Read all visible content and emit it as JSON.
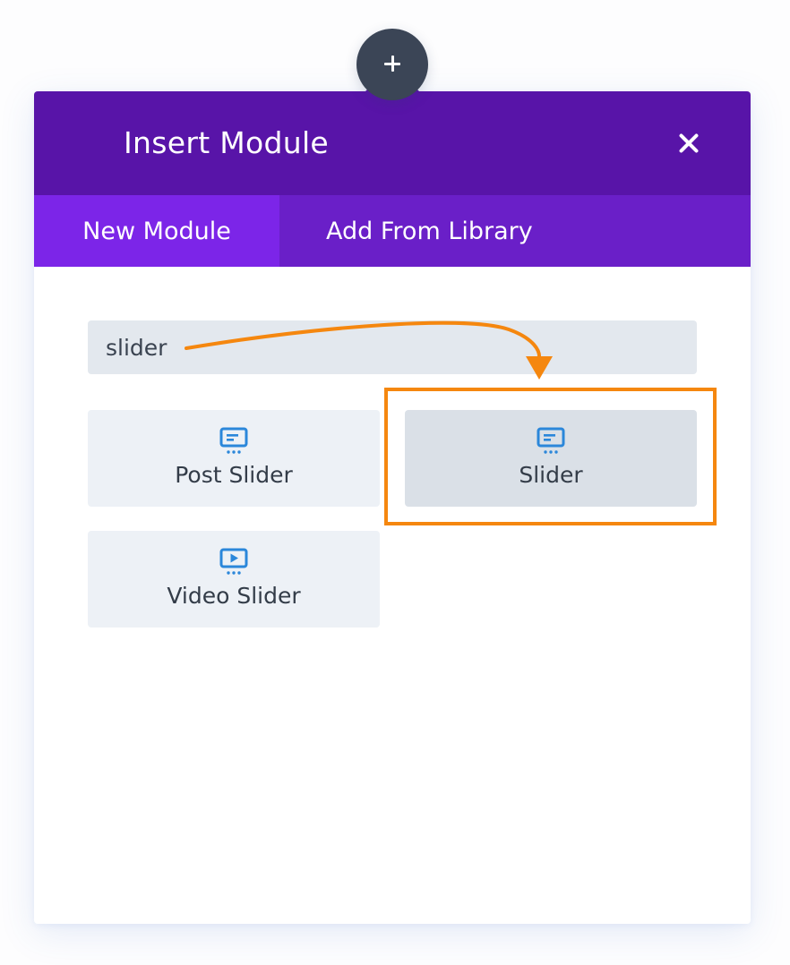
{
  "add_button": {
    "icon": "plus-icon"
  },
  "modal": {
    "title": "Insert Module",
    "close_icon": "close-icon"
  },
  "tabs": [
    {
      "label": "New Module",
      "active": true
    },
    {
      "label": "Add From Library",
      "active": false
    }
  ],
  "search": {
    "value": "slider",
    "placeholder": ""
  },
  "modules": [
    {
      "label": "Post Slider",
      "icon": "slider-icon",
      "selected": false
    },
    {
      "label": "Slider",
      "icon": "slider-icon",
      "selected": true
    },
    {
      "label": "Video Slider",
      "icon": "video-slider-icon",
      "selected": false
    }
  ],
  "colors": {
    "header": "#5814a8",
    "tab_bar": "#6a1fc8",
    "tab_active": "#7c25e8",
    "icon_blue": "#2b87da",
    "annotation_orange": "#f5870f",
    "add_button": "#3b4556"
  }
}
